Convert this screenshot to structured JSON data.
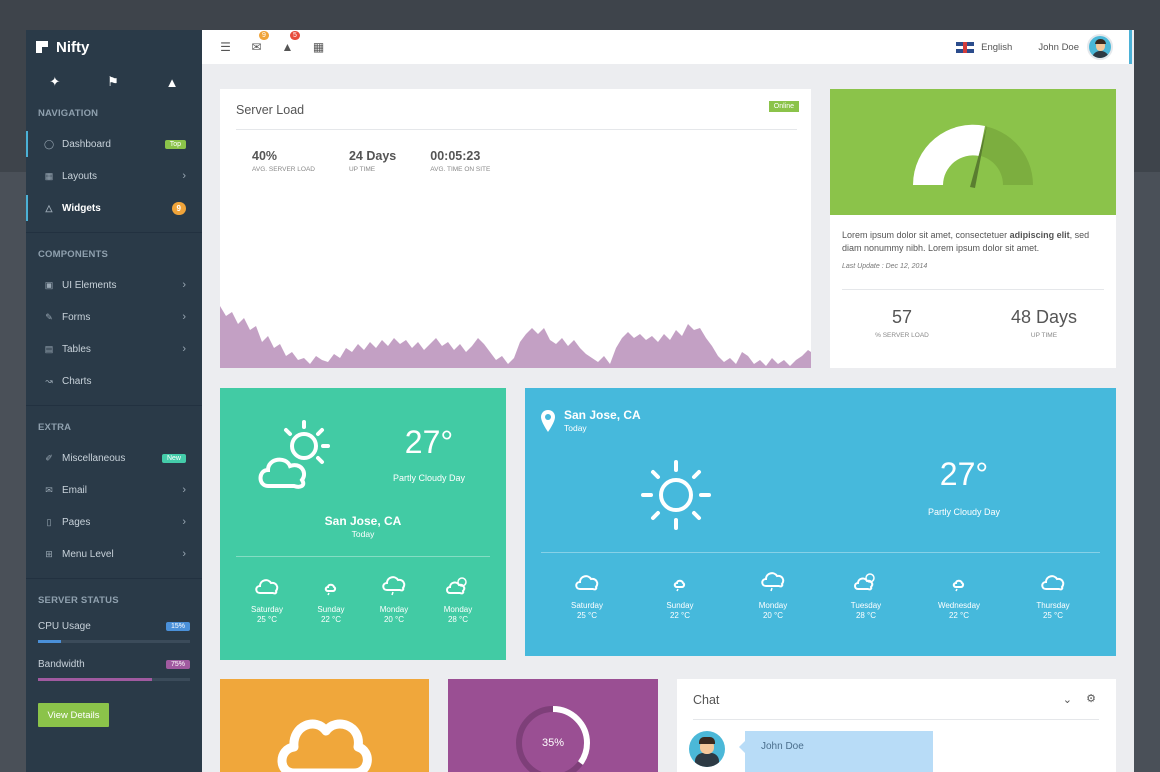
{
  "brand": {
    "name": "Nifty"
  },
  "sidebar": {
    "sections": {
      "navigation": "NAVIGATION",
      "components": "COMPONENTS",
      "extra": "EXTRA",
      "server_status": "SERVER STATUS"
    },
    "nav": [
      {
        "label": "Dashboard",
        "badge": "Top",
        "badge_color": "#8bc34a"
      },
      {
        "label": "Layouts"
      },
      {
        "label": "Widgets",
        "badge": "9",
        "badge_color": "#f0a43a"
      }
    ],
    "components": [
      {
        "label": "UI Elements"
      },
      {
        "label": "Forms"
      },
      {
        "label": "Tables"
      },
      {
        "label": "Charts"
      }
    ],
    "extra": [
      {
        "label": "Miscellaneous",
        "badge": "New",
        "badge_color": "#44ccaa"
      },
      {
        "label": "Email"
      },
      {
        "label": "Pages"
      },
      {
        "label": "Menu Level"
      }
    ],
    "status": [
      {
        "label": "CPU Usage",
        "value": "15%",
        "fraction": 0.15,
        "color": "#4a90d9"
      },
      {
        "label": "Bandwidth",
        "value": "75%",
        "fraction": 0.75,
        "color": "#a05aa0"
      }
    ],
    "view_details": "View Details"
  },
  "topbar": {
    "mail_count": "9",
    "notif_count": "5",
    "language": "English",
    "user": "John Doe"
  },
  "server_load": {
    "title": "Server Load",
    "status": "Online",
    "stats": [
      {
        "value": "40%",
        "label": "AVG. SERVER LOAD"
      },
      {
        "value": "24 Days",
        "label": "UP TIME"
      },
      {
        "value": "00:05:23",
        "label": "AVG. TIME ON SITE"
      }
    ]
  },
  "gauge_panel": {
    "text_a": "Lorem ipsum dolor sit amet, consectetuer ",
    "text_bold": "adipiscing elit",
    "text_b": ", sed diam nonummy nibh. Lorem ipsum dolor sit amet.",
    "last_update": "Last Update : Dec 12, 2014",
    "stat1_value": "57",
    "stat1_label": "% SERVER LOAD",
    "stat2_value": "48 Days",
    "stat2_label": "UP TIME"
  },
  "weather_green": {
    "temp": "27°",
    "desc": "Partly Cloudy Day",
    "city": "San Jose, CA",
    "when": "Today",
    "forecast": [
      {
        "day": "Saturday",
        "temp": "25 °C"
      },
      {
        "day": "Sunday",
        "temp": "22 °C"
      },
      {
        "day": "Monday",
        "temp": "20 °C"
      },
      {
        "day": "Monday",
        "temp": "28 °C"
      }
    ]
  },
  "weather_blue": {
    "city": "San Jose, CA",
    "when": "Today",
    "temp": "27°",
    "desc": "Partly Cloudy Day",
    "forecast": [
      {
        "day": "Saturday",
        "temp": "25 °C"
      },
      {
        "day": "Sunday",
        "temp": "22 °C"
      },
      {
        "day": "Monday",
        "temp": "20 °C"
      },
      {
        "day": "Tuesday",
        "temp": "28 °C"
      },
      {
        "day": "Wednesday",
        "temp": "22 °C"
      },
      {
        "day": "Thursday",
        "temp": "25 °C"
      }
    ]
  },
  "progress_tile": {
    "value": "35%",
    "fraction": 0.35
  },
  "chat": {
    "title": "Chat",
    "messages": [
      {
        "user": "John Doe"
      }
    ]
  },
  "colors": {
    "green_tile": "#8bc34a",
    "teal_tile": "#42cba4",
    "blue_tile": "#46b9dc",
    "orange_tile": "#f0a73b",
    "purple_tile": "#9a4f93",
    "chart_fill": "#c3a0c4"
  }
}
